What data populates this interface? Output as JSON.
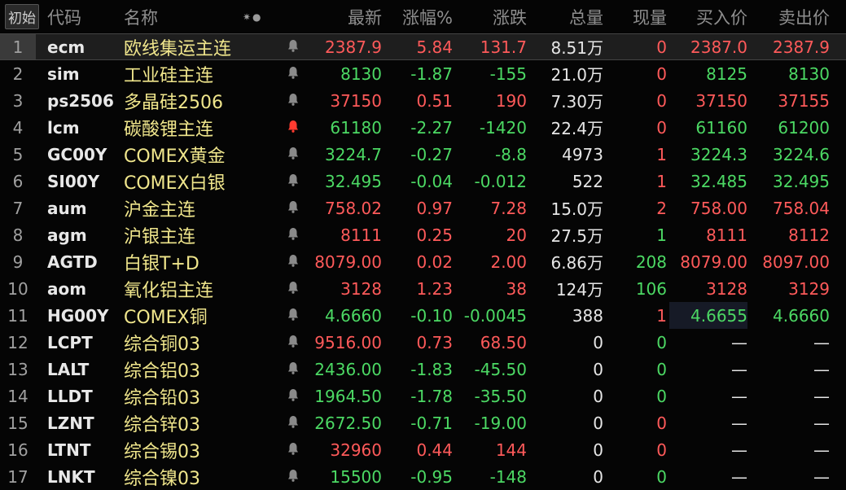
{
  "header": {
    "init_button": "初始",
    "code": "代码",
    "name": "名称",
    "sort_icons": "✷●",
    "last": "最新",
    "pct": "涨幅%",
    "chg": "涨跌",
    "vol": "总量",
    "cur": "现量",
    "bid": "买入价",
    "ask": "卖出价"
  },
  "colors": {
    "up": "#ff5a5a",
    "down": "#4cd964",
    "name": "#f0e68c",
    "background": "#050505"
  },
  "rows": [
    {
      "idx": "1",
      "code": "ecm",
      "name": "欧线集运主连",
      "bell": "bell-icon",
      "last": "2387.9",
      "last_dir": "up",
      "pct": "5.84",
      "pct_dir": "up",
      "chg": "131.7",
      "chg_dir": "up",
      "vol": "8.51万",
      "cur": "0",
      "cur_dir": "up",
      "bid": "2387.0",
      "bid_dir": "up",
      "ask": "2387.9",
      "ask_dir": "up"
    },
    {
      "idx": "2",
      "code": "sim",
      "name": "工业硅主连",
      "bell": "bell-icon",
      "last": "8130",
      "last_dir": "down",
      "pct": "-1.87",
      "pct_dir": "down",
      "chg": "-155",
      "chg_dir": "down",
      "vol": "21.0万",
      "cur": "0",
      "cur_dir": "up",
      "bid": "8125",
      "bid_dir": "down",
      "ask": "8130",
      "ask_dir": "down"
    },
    {
      "idx": "3",
      "code": "ps2506",
      "name": "多晶硅2506",
      "bell": "bell-icon",
      "last": "37150",
      "last_dir": "up",
      "pct": "0.51",
      "pct_dir": "up",
      "chg": "190",
      "chg_dir": "up",
      "vol": "7.30万",
      "cur": "0",
      "cur_dir": "up",
      "bid": "37150",
      "bid_dir": "up",
      "ask": "37155",
      "ask_dir": "up"
    },
    {
      "idx": "4",
      "code": "lcm",
      "name": "碳酸锂主连",
      "bell": "bell-alert-icon",
      "last": "61180",
      "last_dir": "down",
      "pct": "-2.27",
      "pct_dir": "down",
      "chg": "-1420",
      "chg_dir": "down",
      "vol": "22.4万",
      "cur": "0",
      "cur_dir": "up",
      "bid": "61160",
      "bid_dir": "down",
      "ask": "61200",
      "ask_dir": "down"
    },
    {
      "idx": "5",
      "code": "GC00Y",
      "name": "COMEX黄金",
      "bell": "bell-icon",
      "last": "3224.7",
      "last_dir": "down",
      "pct": "-0.27",
      "pct_dir": "down",
      "chg": "-8.8",
      "chg_dir": "down",
      "vol": "4973",
      "cur": "1",
      "cur_dir": "up",
      "bid": "3224.3",
      "bid_dir": "down",
      "ask": "3224.6",
      "ask_dir": "down"
    },
    {
      "idx": "6",
      "code": "SI00Y",
      "name": "COMEX白银",
      "bell": "bell-icon",
      "last": "32.495",
      "last_dir": "down",
      "pct": "-0.04",
      "pct_dir": "down",
      "chg": "-0.012",
      "chg_dir": "down",
      "vol": "522",
      "cur": "1",
      "cur_dir": "up",
      "bid": "32.485",
      "bid_dir": "down",
      "ask": "32.495",
      "ask_dir": "down"
    },
    {
      "idx": "7",
      "code": "aum",
      "name": "沪金主连",
      "bell": "bell-icon",
      "last": "758.02",
      "last_dir": "up",
      "pct": "0.97",
      "pct_dir": "up",
      "chg": "7.28",
      "chg_dir": "up",
      "vol": "15.0万",
      "cur": "2",
      "cur_dir": "up",
      "bid": "758.00",
      "bid_dir": "up",
      "ask": "758.04",
      "ask_dir": "up"
    },
    {
      "idx": "8",
      "code": "agm",
      "name": "沪银主连",
      "bell": "bell-icon",
      "last": "8111",
      "last_dir": "up",
      "pct": "0.25",
      "pct_dir": "up",
      "chg": "20",
      "chg_dir": "up",
      "vol": "27.5万",
      "cur": "1",
      "cur_dir": "down",
      "bid": "8111",
      "bid_dir": "up",
      "ask": "8112",
      "ask_dir": "up"
    },
    {
      "idx": "9",
      "code": "AGTD",
      "name": "白银T+D",
      "bell": "bell-icon",
      "last": "8079.00",
      "last_dir": "up",
      "pct": "0.02",
      "pct_dir": "up",
      "chg": "2.00",
      "chg_dir": "up",
      "vol": "6.86万",
      "cur": "208",
      "cur_dir": "down",
      "bid": "8079.00",
      "bid_dir": "up",
      "ask": "8097.00",
      "ask_dir": "up"
    },
    {
      "idx": "10",
      "code": "aom",
      "name": "氧化铝主连",
      "bell": "bell-icon",
      "last": "3128",
      "last_dir": "up",
      "pct": "1.23",
      "pct_dir": "up",
      "chg": "38",
      "chg_dir": "up",
      "vol": "124万",
      "cur": "106",
      "cur_dir": "down",
      "bid": "3128",
      "bid_dir": "up",
      "ask": "3129",
      "ask_dir": "up"
    },
    {
      "idx": "11",
      "code": "HG00Y",
      "name": "COMEX铜",
      "bell": "bell-icon",
      "last": "4.6660",
      "last_dir": "down",
      "pct": "-0.10",
      "pct_dir": "down",
      "chg": "-0.0045",
      "chg_dir": "down",
      "vol": "388",
      "cur": "1",
      "cur_dir": "up",
      "bid": "4.6655",
      "bid_dir": "down",
      "ask": "4.6660",
      "ask_dir": "down",
      "bid_highlight": true
    },
    {
      "idx": "12",
      "code": "LCPT",
      "name": "综合铜03",
      "bell": "bell-icon",
      "last": "9516.00",
      "last_dir": "up",
      "pct": "0.73",
      "pct_dir": "up",
      "chg": "68.50",
      "chg_dir": "up",
      "vol": "0",
      "cur": "0",
      "cur_dir": "down",
      "bid": "—",
      "bid_dir": "dash",
      "ask": "—",
      "ask_dir": "dash"
    },
    {
      "idx": "13",
      "code": "LALT",
      "name": "综合铝03",
      "bell": "bell-icon",
      "last": "2436.00",
      "last_dir": "down",
      "pct": "-1.83",
      "pct_dir": "down",
      "chg": "-45.50",
      "chg_dir": "down",
      "vol": "0",
      "cur": "0",
      "cur_dir": "down",
      "bid": "—",
      "bid_dir": "dash",
      "ask": "—",
      "ask_dir": "dash"
    },
    {
      "idx": "14",
      "code": "LLDT",
      "name": "综合铅03",
      "bell": "bell-icon",
      "last": "1964.50",
      "last_dir": "down",
      "pct": "-1.78",
      "pct_dir": "down",
      "chg": "-35.50",
      "chg_dir": "down",
      "vol": "0",
      "cur": "0",
      "cur_dir": "down",
      "bid": "—",
      "bid_dir": "dash",
      "ask": "—",
      "ask_dir": "dash"
    },
    {
      "idx": "15",
      "code": "LZNT",
      "name": "综合锌03",
      "bell": "bell-icon",
      "last": "2672.50",
      "last_dir": "down",
      "pct": "-0.71",
      "pct_dir": "down",
      "chg": "-19.00",
      "chg_dir": "down",
      "vol": "0",
      "cur": "0",
      "cur_dir": "up",
      "bid": "—",
      "bid_dir": "dash",
      "ask": "—",
      "ask_dir": "dash"
    },
    {
      "idx": "16",
      "code": "LTNT",
      "name": "综合锡03",
      "bell": "bell-icon",
      "last": "32960",
      "last_dir": "up",
      "pct": "0.44",
      "pct_dir": "up",
      "chg": "144",
      "chg_dir": "up",
      "vol": "0",
      "cur": "0",
      "cur_dir": "up",
      "bid": "—",
      "bid_dir": "dash",
      "ask": "—",
      "ask_dir": "dash"
    },
    {
      "idx": "17",
      "code": "LNKT",
      "name": "综合镍03",
      "bell": "bell-icon",
      "last": "15500",
      "last_dir": "down",
      "pct": "-0.95",
      "pct_dir": "down",
      "chg": "-148",
      "chg_dir": "down",
      "vol": "0",
      "cur": "0",
      "cur_dir": "down",
      "bid": "—",
      "bid_dir": "dash",
      "ask": "—",
      "ask_dir": "dash"
    }
  ]
}
